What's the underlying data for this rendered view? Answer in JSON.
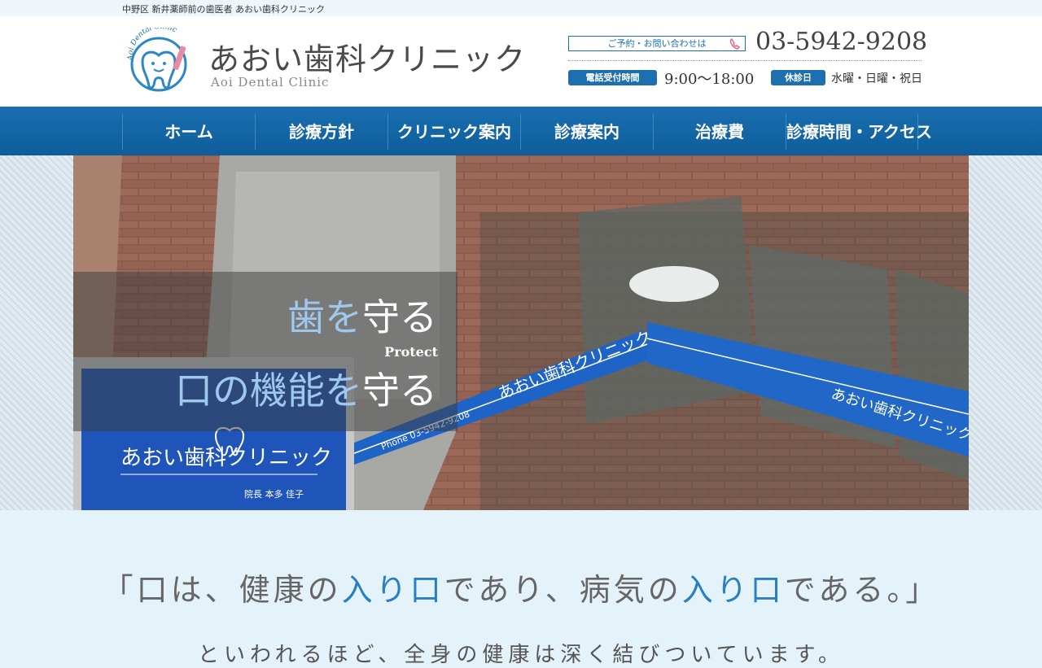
{
  "topbar": {
    "text": "中野区 新井薬師前の歯医者 あおい歯科クリニック"
  },
  "header": {
    "logo_title": "あおい歯科クリニック",
    "logo_subtitle": "Aoi Dental Clinic",
    "logo_arc_text": "Aoi Dental Clinic",
    "contact_label": "ご予約・お問い合わせは",
    "phone": "03-5942-9208",
    "hours_label": "電話受付時間",
    "hours_value": "9:00〜18:00",
    "closed_label": "休診日",
    "closed_value": "水曜・日曜・祝日"
  },
  "nav": {
    "items": [
      {
        "label": "ホーム"
      },
      {
        "label": "診療方針"
      },
      {
        "label": "クリニック案内"
      },
      {
        "label": "診療案内"
      },
      {
        "label": "治療費"
      },
      {
        "label": "診療時間・アクセス"
      }
    ]
  },
  "hero": {
    "slogan_1a": "歯を",
    "slogan_1b": "守る",
    "slogan_mid": "Protect",
    "slogan_2a": "口の機能を",
    "slogan_2b": "守る",
    "sign_name": "あおい歯科クリニック",
    "sign_director": "院長 本多 佳子",
    "banner_phone": "Phone 03-5942-9208"
  },
  "main": {
    "quote_open": "「口は、健康の",
    "quote_h1": "入り口",
    "quote_mid": "であり、病気の",
    "quote_h2": "入り口",
    "quote_close": "である。」",
    "intro": "といわれるほど、全身の健康は深く結びついています。"
  },
  "colors": {
    "brand_blue": "#1d6fb0",
    "nav_blue": "#0e5d9b",
    "page_bg": "#e4f3fa"
  }
}
